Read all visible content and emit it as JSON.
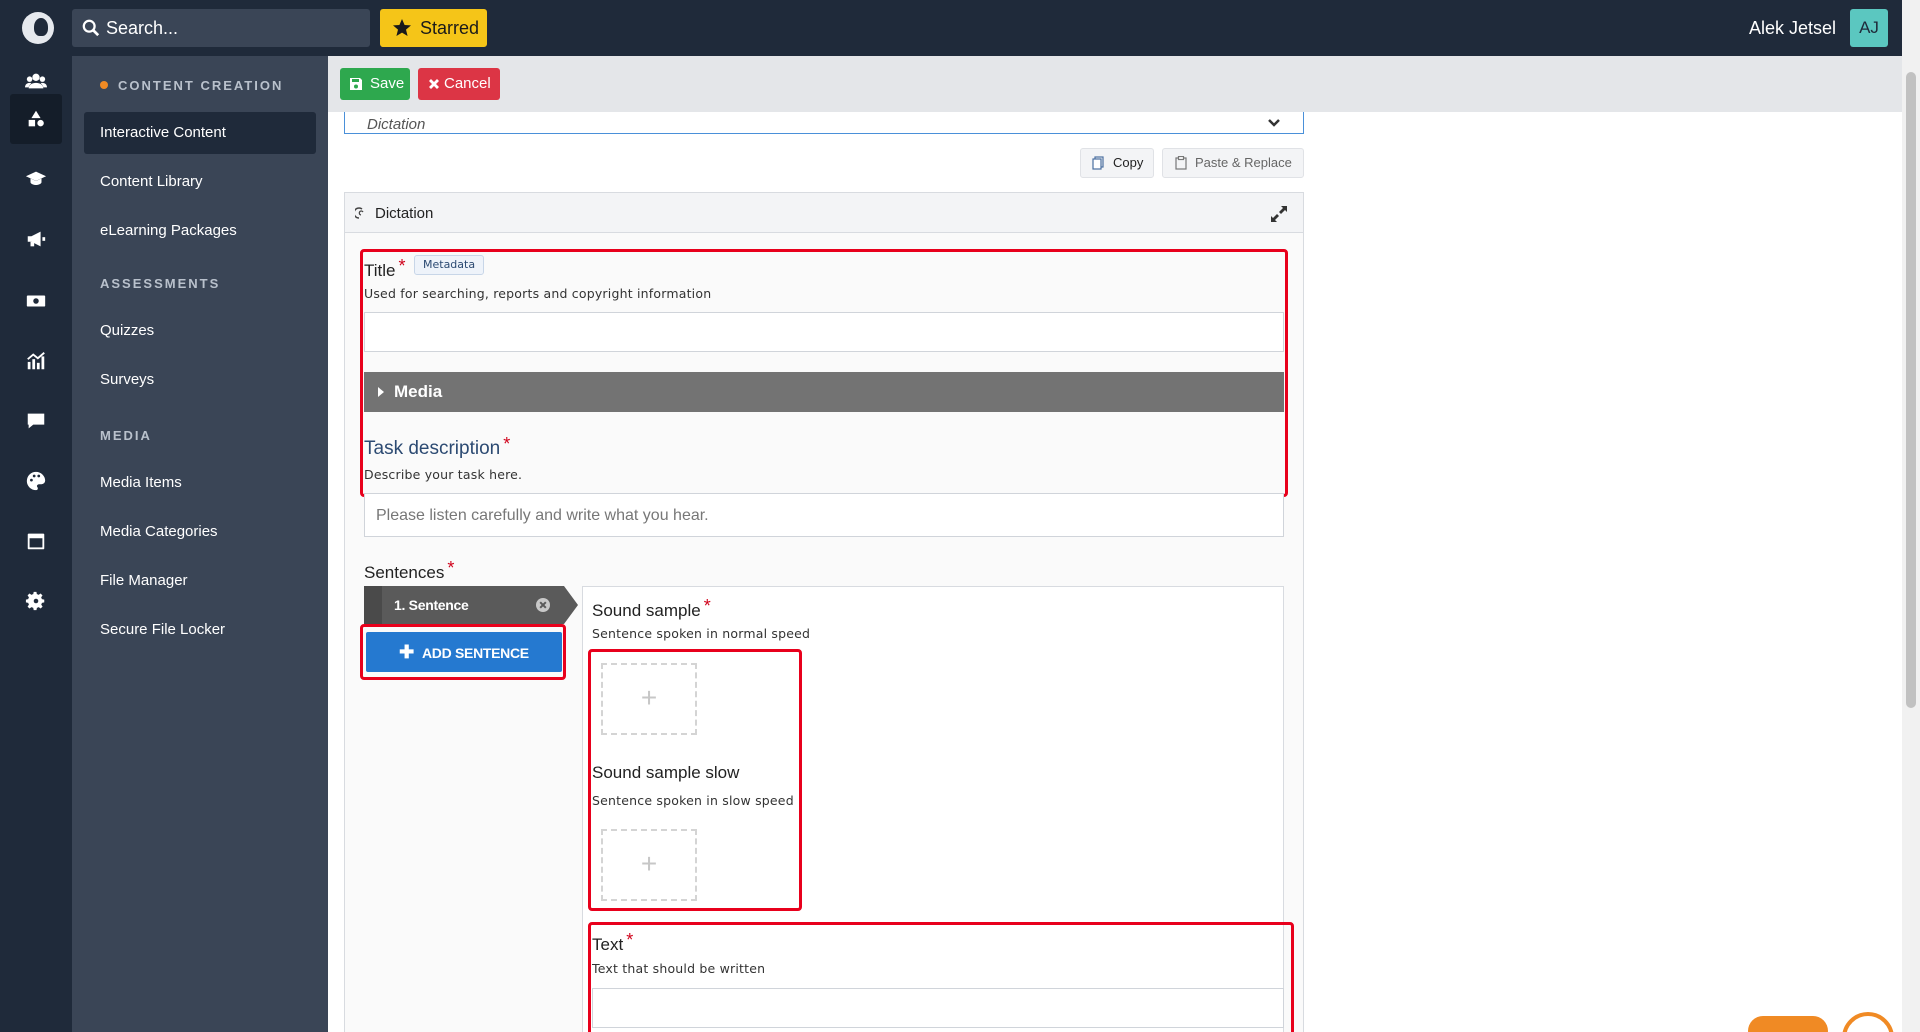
{
  "topbar": {
    "search_placeholder": "Search...",
    "starred_label": "Starred",
    "user_name": "Alek Jetsel",
    "avatar_initials": "AJ",
    "accent_color": "#f5c518"
  },
  "rail": {
    "icons": [
      "users-icon",
      "shapes-icon",
      "graduation-cap-icon",
      "megaphone-icon",
      "money-icon",
      "chart-icon",
      "chat-icon",
      "palette-icon",
      "calendar-icon",
      "gear-icon"
    ],
    "active": "shapes-icon"
  },
  "sidenav": {
    "sections": [
      {
        "heading": "CONTENT CREATION",
        "items": [
          "Interactive Content",
          "Content Library",
          "eLearning Packages"
        ]
      },
      {
        "heading": "ASSESSMENTS",
        "items": [
          "Quizzes",
          "Surveys"
        ]
      },
      {
        "heading": "MEDIA",
        "items": [
          "Media Items",
          "Media Categories",
          "File Manager",
          "Secure File Locker"
        ]
      }
    ],
    "active_item": "Interactive Content"
  },
  "actions": {
    "save_label": "Save",
    "cancel_label": "Cancel",
    "save_color": "#2ea84e",
    "cancel_color": "#dc3545"
  },
  "editor": {
    "content_type": "Dictation",
    "copy_label": "Copy",
    "paste_label": "Paste & Replace",
    "panel_title": "Dictation",
    "title_field": {
      "label": "Title",
      "tag": "Metadata",
      "description": "Used for searching, reports and copyright information",
      "value": ""
    },
    "media_label": "Media",
    "task_field": {
      "label": "Task description",
      "description": "Describe your task here.",
      "placeholder": "Please listen carefully and write what you hear."
    },
    "sentences_label": "Sentences",
    "sentence_tab": "1. Sentence",
    "add_sentence_label": "ADD SENTENCE",
    "sound_sample": {
      "label": "Sound sample",
      "description": "Sentence spoken in normal speed"
    },
    "sound_sample_slow": {
      "label": "Sound sample slow",
      "description": "Sentence spoken in slow speed"
    },
    "text_field": {
      "label": "Text",
      "description": "Text that should be written",
      "value": ""
    },
    "upload_glyph": "+",
    "required_mark": "*"
  }
}
